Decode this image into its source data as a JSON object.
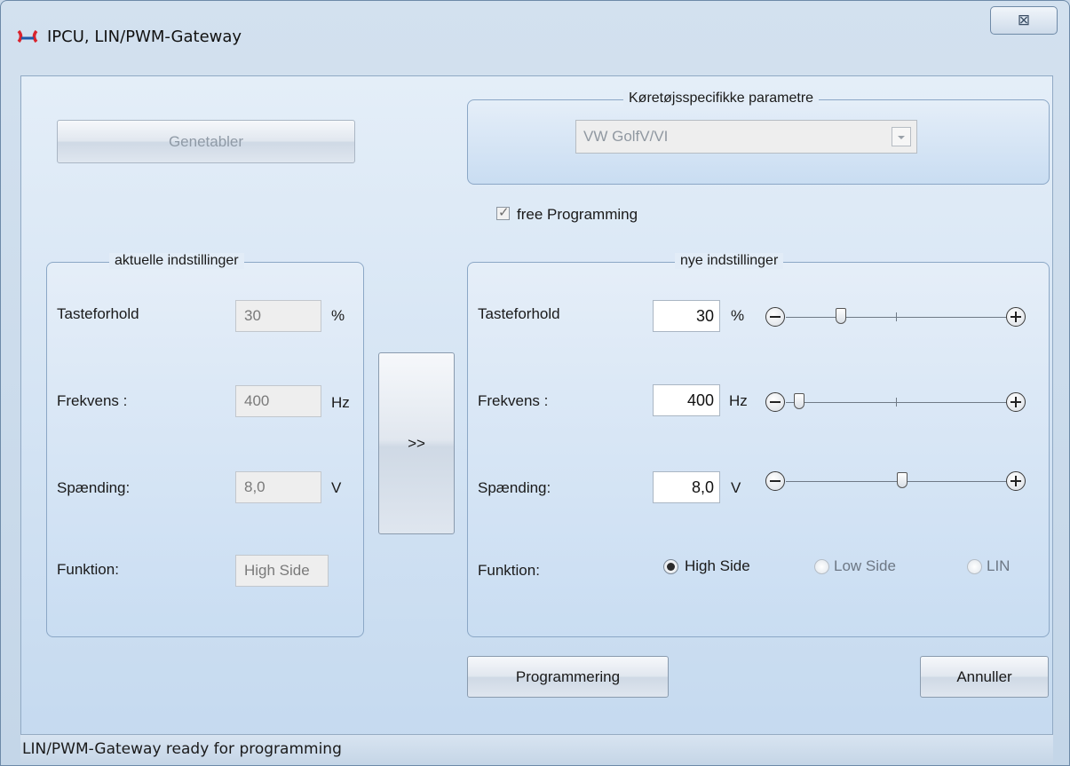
{
  "window": {
    "title": "IPCU, LIN/PWM-Gateway",
    "close_glyph": "⊠"
  },
  "buttons": {
    "genetabler": "Genetabler",
    "transfer": ">>",
    "programmering": "Programmering",
    "annuller": "Annuller"
  },
  "vehicle_group": {
    "title": "Køretøjsspecifikke parametre",
    "selected": "VW GolfV/VI"
  },
  "free_programming": {
    "label": "free Programming",
    "checked": true
  },
  "current": {
    "title": "aktuelle indstillinger",
    "tasteforhold": {
      "label": "Tasteforhold",
      "value": "30",
      "unit": "%"
    },
    "frekvens": {
      "label": "Frekvens :",
      "value": "400",
      "unit": "Hz"
    },
    "spaending": {
      "label": "Spænding:",
      "value": "8,0",
      "unit": "V"
    },
    "funktion": {
      "label": "Funktion:",
      "value": "High Side"
    }
  },
  "new": {
    "title": "nye indstillinger",
    "tasteforhold": {
      "label": "Tasteforhold",
      "value": "30",
      "unit": "%",
      "slider_level": 0.25
    },
    "frekvens": {
      "label": "Frekvens :",
      "value": "400",
      "unit": "Hz",
      "slider_level": 0.06
    },
    "spaending": {
      "label": "Spænding:",
      "value": "8,0",
      "unit": "V",
      "slider_level": 0.53
    },
    "funktion": {
      "label": "Funktion:",
      "options": [
        "High Side",
        "Low Side",
        "LIN"
      ],
      "selected": "High Side"
    }
  },
  "status": {
    "text": "LIN/PWM-Gateway ready for programming"
  },
  "icons": {
    "app": "gateway-logo-icon",
    "close": "close-icon",
    "minus": "minus-icon",
    "plus": "plus-icon"
  },
  "colors": {
    "logo_red": "#d9232d",
    "logo_blue": "#1f5aa8"
  }
}
